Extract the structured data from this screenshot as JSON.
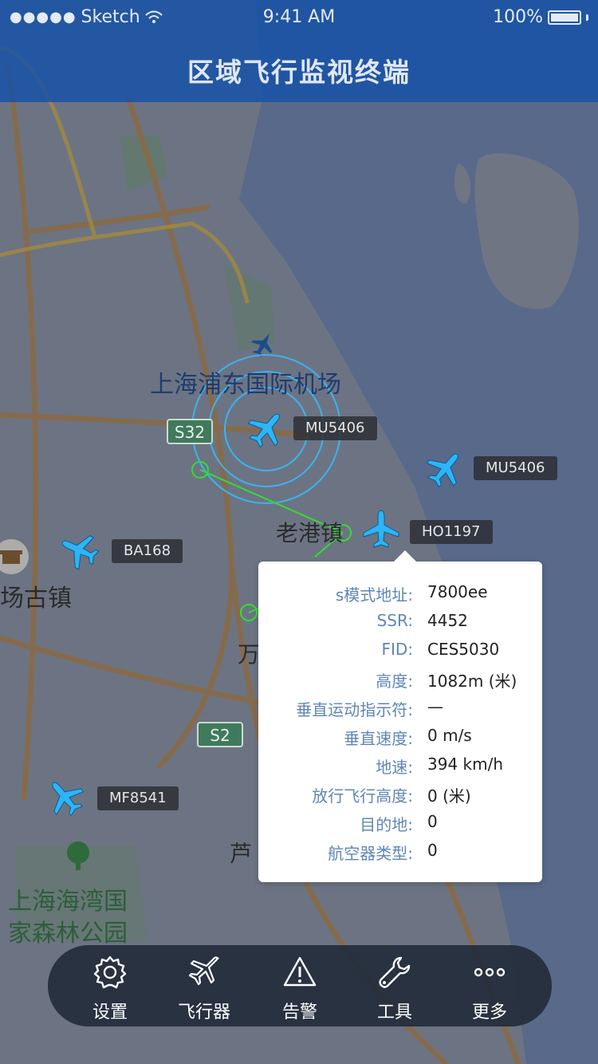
{
  "status_bar": {
    "carrier": "Sketch",
    "time": "9:41 AM",
    "battery": "100%"
  },
  "nav": {
    "title": "区域飞行监视终端"
  },
  "map_labels": {
    "airport": "上海浦东国际机场",
    "town1": "老港镇",
    "town2": "万",
    "town3": "芦",
    "town4": "场古镇",
    "park_line1": "上海海湾国",
    "park_line2": "家森林公园",
    "road1": "S32",
    "road2": "S2"
  },
  "flights": [
    {
      "id": "MU5406_a",
      "label": "MU5406"
    },
    {
      "id": "MU5406_b",
      "label": "MU5406"
    },
    {
      "id": "HO1197",
      "label": "HO1197"
    },
    {
      "id": "BA168",
      "label": "BA168"
    },
    {
      "id": "MF8541",
      "label": "MF8541"
    }
  ],
  "detail": {
    "rows": [
      {
        "label": "s模式地址:",
        "value": "7800ee"
      },
      {
        "label": "SSR:",
        "value": "4452"
      },
      {
        "label": "FID:",
        "value": "CES5030"
      },
      {
        "label": "高度:",
        "value": "1082m (米)"
      },
      {
        "label": "垂直运动指示符:",
        "value": "—"
      },
      {
        "label": "垂直速度:",
        "value": "0 m/s"
      },
      {
        "label": "地速:",
        "value": "394 km/h"
      },
      {
        "label": "放行飞行高度:",
        "value": "0 (米)"
      },
      {
        "label": "目的地:",
        "value": "0"
      },
      {
        "label": "航空器类型:",
        "value": "0"
      }
    ]
  },
  "tabs": [
    {
      "label": "设置",
      "icon": "gear-icon"
    },
    {
      "label": "飞行器",
      "icon": "airplane-icon"
    },
    {
      "label": "告警",
      "icon": "warning-icon"
    },
    {
      "label": "工具",
      "icon": "wrench-icon"
    },
    {
      "label": "更多",
      "icon": "more-icon"
    }
  ],
  "colors": {
    "plane": "#2fb4f5",
    "range_ring": "#3bb3ef",
    "track": "#33dd33"
  }
}
